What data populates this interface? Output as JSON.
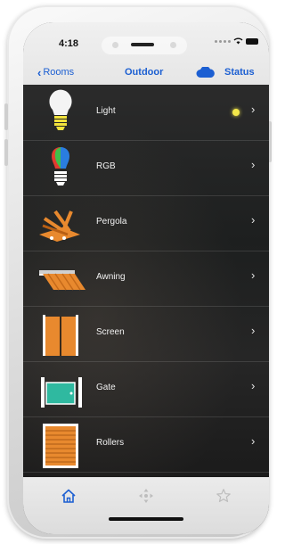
{
  "status_bar": {
    "time": "4:18"
  },
  "header": {
    "back_label": "Rooms",
    "title": "Outdoor",
    "status_label": "Status"
  },
  "items": [
    {
      "label": "Light",
      "icon": "light-bulb-icon",
      "indicator": "#f4e84a"
    },
    {
      "label": "RGB",
      "icon": "rgb-bulb-icon"
    },
    {
      "label": "Pergola",
      "icon": "pergola-icon"
    },
    {
      "label": "Awning",
      "icon": "awning-icon"
    },
    {
      "label": "Screen",
      "icon": "screen-icon"
    },
    {
      "label": "Gate",
      "icon": "gate-icon"
    },
    {
      "label": "Rollers",
      "icon": "rollers-icon"
    }
  ],
  "tabs": [
    {
      "icon": "home-icon",
      "selected": true
    },
    {
      "icon": "move-icon",
      "selected": false
    },
    {
      "icon": "star-icon",
      "selected": false
    }
  ],
  "colors": {
    "accent": "#1c5fd2",
    "orange": "#e8892e"
  }
}
